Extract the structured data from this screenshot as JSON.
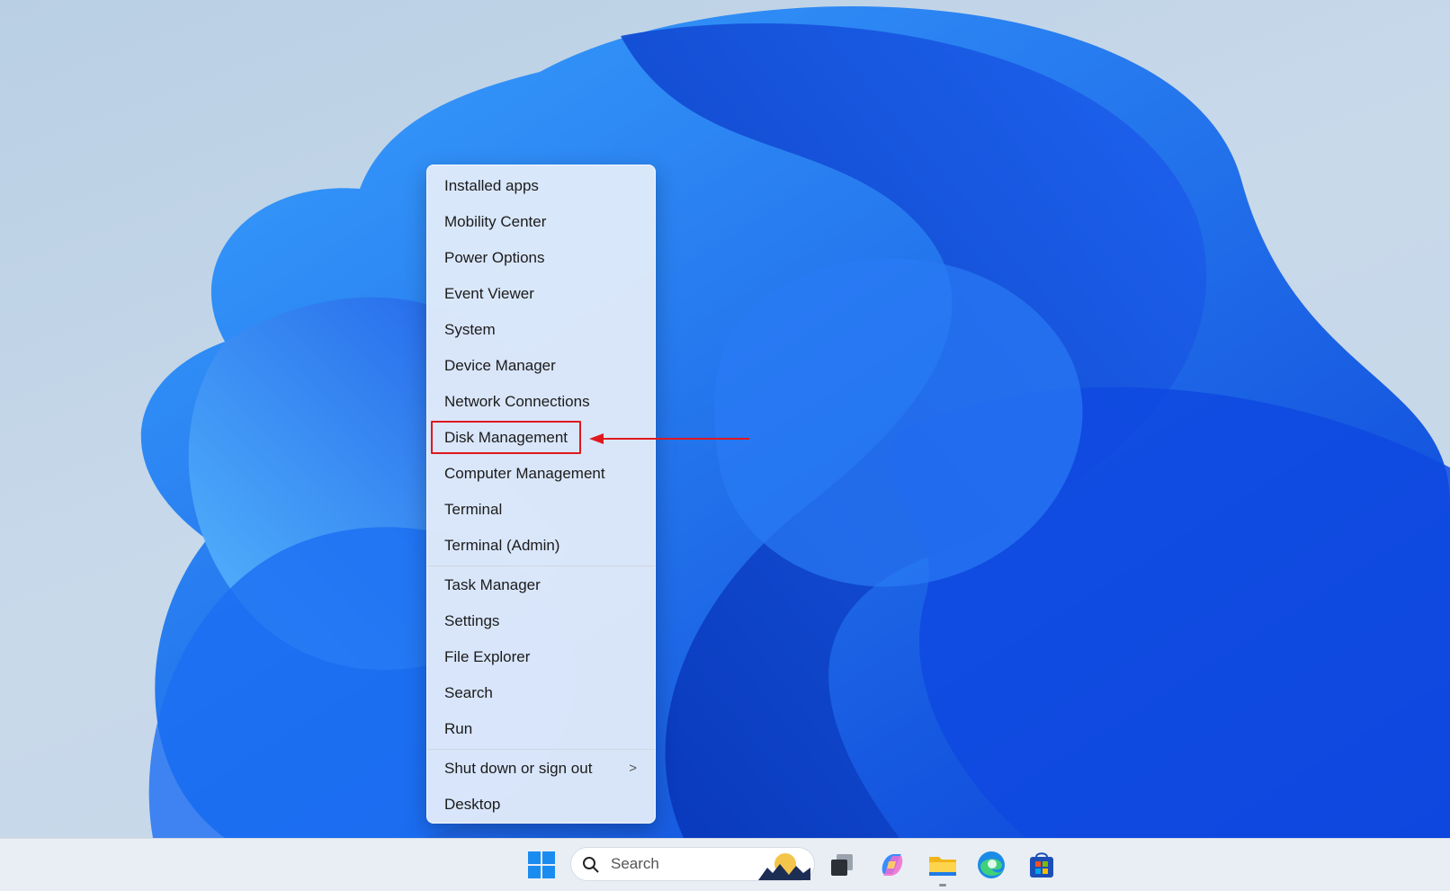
{
  "menu": {
    "items": [
      {
        "label": "Installed apps"
      },
      {
        "label": "Mobility Center"
      },
      {
        "label": "Power Options"
      },
      {
        "label": "Event Viewer"
      },
      {
        "label": "System"
      },
      {
        "label": "Device Manager"
      },
      {
        "label": "Network Connections"
      },
      {
        "label": "Disk Management"
      },
      {
        "label": "Computer Management"
      },
      {
        "label": "Terminal"
      },
      {
        "label": "Terminal (Admin)"
      },
      {
        "label": "Task Manager"
      },
      {
        "label": "Settings"
      },
      {
        "label": "File Explorer"
      },
      {
        "label": "Search"
      },
      {
        "label": "Run"
      },
      {
        "label": "Shut down or sign out"
      },
      {
        "label": "Desktop"
      }
    ],
    "submenu_chevron": ">"
  },
  "annotation": {
    "highlighted_item": "Disk Management",
    "color": "#e0181e"
  },
  "taskbar": {
    "search_label": "Search",
    "icons": [
      "windows-start-icon",
      "search-icon",
      "task-view-icon",
      "copilot-icon",
      "file-explorer-icon",
      "edge-icon",
      "store-icon"
    ]
  }
}
